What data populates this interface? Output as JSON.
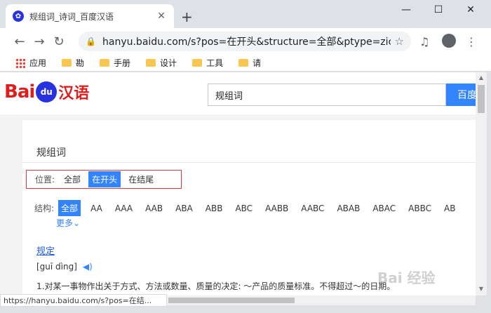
{
  "browser": {
    "tab_title": "规组词_诗词_百度汉语",
    "tab_favicon": "paw-icon",
    "url": "hanyu.baidu.com/s?pos=在开头&structure=全部&ptype=zici...",
    "status_url": "https://hanyu.baidu.com/s?pos=在结..."
  },
  "bookmarks": [
    {
      "label": "应用",
      "icon": "apps-icon"
    },
    {
      "label": "勘",
      "icon": "folder-icon"
    },
    {
      "label": "手册",
      "icon": "folder-icon"
    },
    {
      "label": "设计",
      "icon": "folder-icon"
    },
    {
      "label": "工具",
      "icon": "folder-icon"
    },
    {
      "label": "请",
      "icon": "folder-icon"
    }
  ],
  "site": {
    "logo_bai": "Bai",
    "logo_du": "du",
    "logo_hy": "汉语",
    "search_value": "规组词",
    "search_button": "百度"
  },
  "result": {
    "title": "规组词",
    "position_label": "位置:",
    "positions": [
      "全部",
      "在开头",
      "在结尾"
    ],
    "position_selected": 1,
    "structure_label": "结构:",
    "structures": [
      "全部",
      "AA",
      "AAA",
      "AAB",
      "ABA",
      "ABB",
      "ABC",
      "AABB",
      "AABC",
      "ABAB",
      "ABAC",
      "ABBC",
      "AB"
    ],
    "structure_selected": 0,
    "more": "更多",
    "entry_word": "规定",
    "entry_pinyin": "[guī dìng]",
    "entry_definition": "1.对某一事物作出关于方式、方法或数量、质量的决定: ～产品的质量标准。不得超过～的日期。"
  },
  "watermark": "Bai 经验",
  "colors": {
    "accent": "#3385ff",
    "brand_red": "#de1e1e",
    "highlight_border": "#e0393e"
  }
}
